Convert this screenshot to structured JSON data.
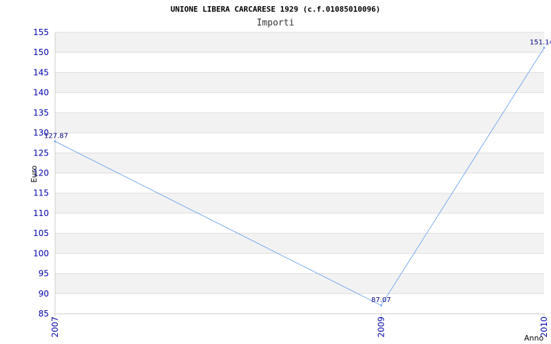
{
  "chart_data": {
    "type": "line",
    "title": "UNIONE LIBERA CARCARESE 1929 (c.f.01085010096)",
    "subtitle": "Importi",
    "xlabel": "Anno",
    "ylabel": "Euro",
    "x": [
      "2007",
      "2009",
      "2010"
    ],
    "values": [
      127.87,
      87.07,
      151.14
    ],
    "data_labels": [
      "127.87",
      "87.07",
      "151.14"
    ],
    "ylim": [
      85,
      155
    ],
    "yticks": [
      85,
      90,
      95,
      100,
      105,
      110,
      115,
      120,
      125,
      130,
      135,
      140,
      145,
      150,
      155
    ],
    "grid": "horizontal alternating bands",
    "colors": {
      "line": "#77aaee",
      "band": "#f2f2f2",
      "tick_text": "#0000aa",
      "label_text": "#000080"
    }
  }
}
